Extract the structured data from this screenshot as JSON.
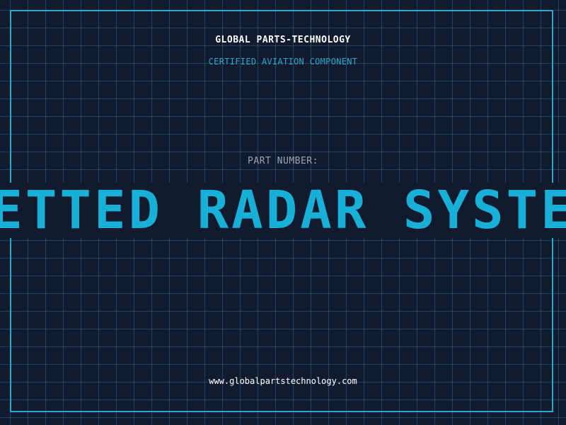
{
  "header": {
    "company_name": "GLOBAL PARTS-TECHNOLOGY",
    "tagline": "CERTIFIED AVIATION COMPONENT"
  },
  "part": {
    "label": "PART NUMBER:",
    "title": "NETTED RADAR SYSTEM"
  },
  "footer": {
    "website": "www.globalpartstechnology.com"
  },
  "colors": {
    "background": "#111a2e",
    "grid": "#287896",
    "accent": "#18b0d6",
    "frame": "#2aa9cc"
  }
}
